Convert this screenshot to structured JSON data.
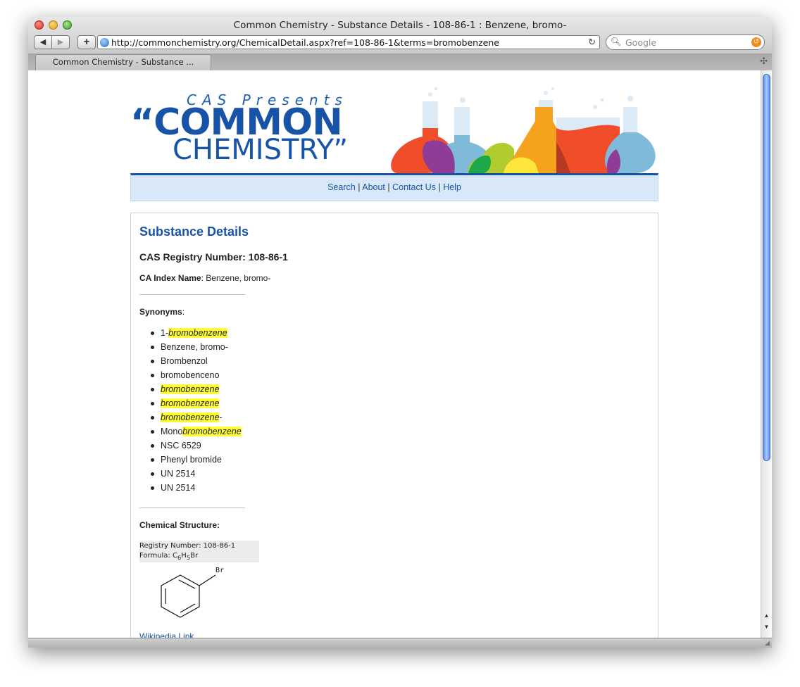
{
  "window": {
    "title": "Common Chemistry - Substance Details - 108-86-1 : Benzene, bromo-",
    "url": "http://commonchemistry.org/ChemicalDetail.aspx?ref=108-86-1&terms=bromobenzene",
    "search_placeholder": "Google",
    "tab_title": "Common Chemistry - Substance ...",
    "back_icon": "◀",
    "forward_icon": "▶",
    "new_tab_icon": "+",
    "reload_icon": "↻",
    "tab_add_icon": "✣"
  },
  "banner": {
    "presents": "CAS Presents",
    "logo_line1": "“COMMON",
    "logo_line2": "CHEMISTRY”",
    "colors": [
      "#f04e2a",
      "#7fbad8",
      "#b0cc2e",
      "#f5a21e",
      "#ffe63a",
      "#8e3c96",
      "#1ea84a"
    ]
  },
  "nav": {
    "search": "Search",
    "about": "About",
    "contact": "Contact Us",
    "help": "Help",
    "sep": "|"
  },
  "details": {
    "title": "Substance Details",
    "cas_label": "CAS Registry Number: 108-86-1",
    "index_label": "CA Index Name",
    "index_value": ": Benzene, bromo-",
    "synonyms_label": "Synonyms",
    "synonyms_colon": ":",
    "structure_label": "Chemical Structure:",
    "registry_line": "Registry Number: 108-86-1",
    "formula_prefix": "Formula: C",
    "formula_sub1": "6",
    "formula_mid": "H",
    "formula_sub2": "5",
    "formula_suffix": "Br",
    "molecule_label": "Br",
    "wiki_link": "Wikipedia Link"
  },
  "synonyms": [
    {
      "pre": "1-",
      "hl": "bromobenzene",
      "post": ""
    },
    {
      "pre": "Benzene, bromo-",
      "hl": "",
      "post": ""
    },
    {
      "pre": "Brombenzol",
      "hl": "",
      "post": ""
    },
    {
      "pre": "bromobenceno",
      "hl": "",
      "post": ""
    },
    {
      "pre": "",
      "hl": "bromobenzene",
      "post": ""
    },
    {
      "pre": "",
      "hl": "bromobenzene",
      "post": ""
    },
    {
      "pre": "",
      "hl": "bromobenzene",
      "post": "-"
    },
    {
      "pre": "Mono",
      "hl": "bromobenzene",
      "post": ""
    },
    {
      "pre": "NSC 6529",
      "hl": "",
      "post": ""
    },
    {
      "pre": "Phenyl bromide",
      "hl": "",
      "post": ""
    },
    {
      "pre": "UN 2514",
      "hl": "",
      "post": ""
    },
    {
      "pre": "UN 2514",
      "hl": "",
      "post": ""
    }
  ]
}
